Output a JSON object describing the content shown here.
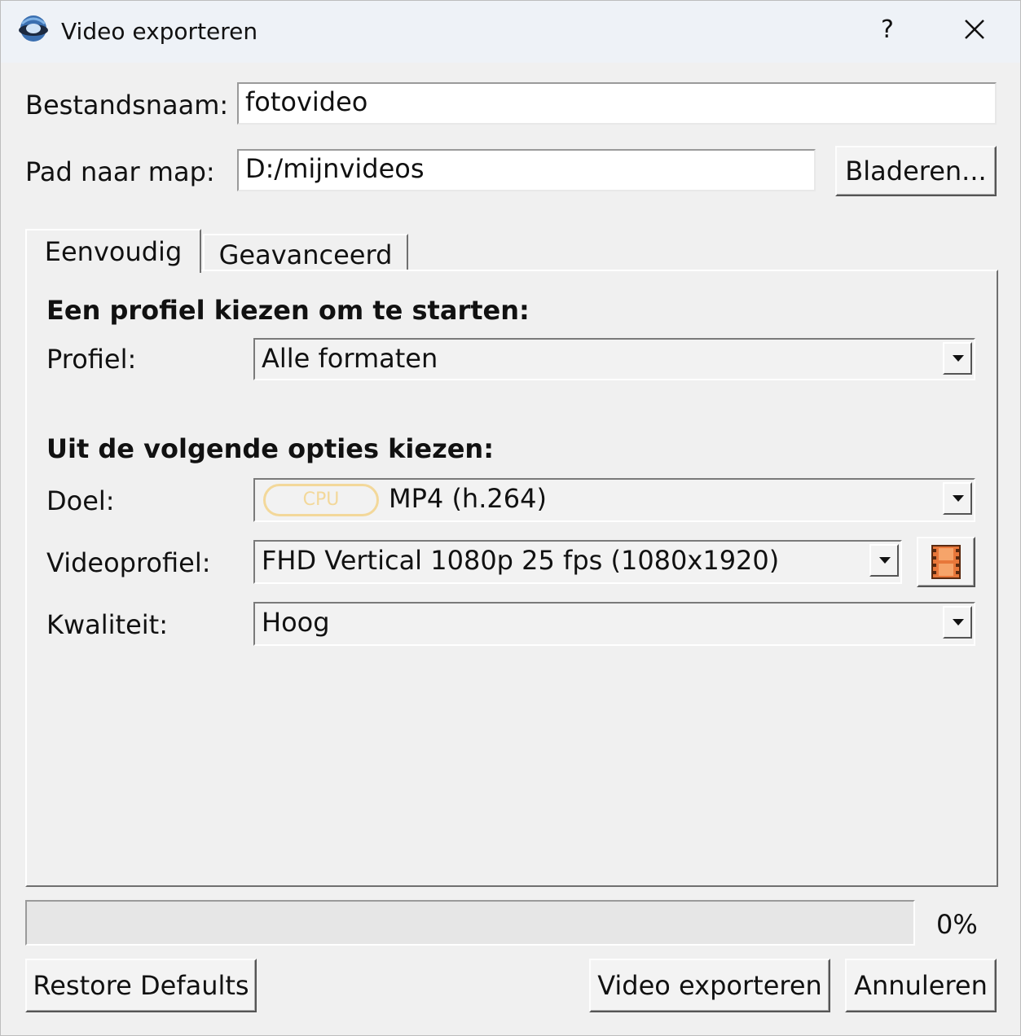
{
  "window": {
    "title": "Video exporteren",
    "help_label": "?"
  },
  "file": {
    "filename_label": "Bestandsnaam:",
    "filename_value": "fotovideo",
    "path_label": "Pad naar map:",
    "path_value": "D:/mijnvideos",
    "browse_label": "Bladeren..."
  },
  "tabs": [
    {
      "label": "Eenvoudig",
      "active": true
    },
    {
      "label": "Geavanceerd",
      "active": false
    }
  ],
  "simple": {
    "profile_heading": "Een profiel kiezen om te starten:",
    "profile_label": "Profiel:",
    "profile_value": "Alle formaten",
    "options_heading": "Uit de volgende opties kiezen:",
    "target_label": "Doel:",
    "target_badge": "CPU",
    "target_value": "MP4 (h.264)",
    "video_profile_label": "Videoprofiel:",
    "video_profile_value": "FHD Vertical 1080p 25 fps (1080x1920)",
    "quality_label": "Kwaliteit:",
    "quality_value": "Hoog"
  },
  "progress": {
    "value": 0,
    "text": "0%"
  },
  "footer": {
    "restore_label": "Restore Defaults",
    "export_label": "Video exporteren",
    "cancel_label": "Annuleren"
  },
  "colors": {
    "cpu_badge": "#f3d89a",
    "film_icon": "#e8773a"
  }
}
